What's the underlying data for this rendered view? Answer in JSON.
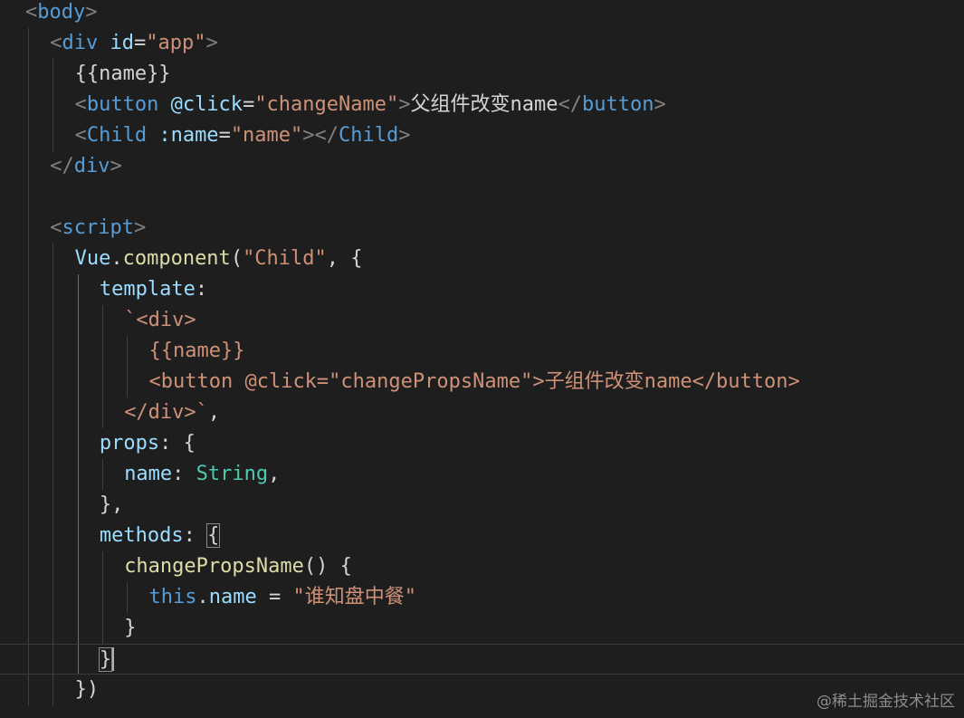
{
  "editor": {
    "language": "html",
    "lines": [
      [
        {
          "t": "punct",
          "v": "<"
        },
        {
          "t": "tag",
          "v": "body"
        },
        {
          "t": "punct",
          "v": ">"
        }
      ],
      [
        {
          "t": "punct",
          "v": "<"
        },
        {
          "t": "tag",
          "v": "div"
        },
        {
          "t": "text",
          "v": " "
        },
        {
          "t": "attr",
          "v": "id"
        },
        {
          "t": "text",
          "v": "="
        },
        {
          "t": "string",
          "v": "\"app\""
        },
        {
          "t": "punct",
          "v": ">"
        }
      ],
      [
        {
          "t": "text",
          "v": "{{name}}"
        }
      ],
      [
        {
          "t": "punct",
          "v": "<"
        },
        {
          "t": "tag",
          "v": "button"
        },
        {
          "t": "text",
          "v": " "
        },
        {
          "t": "attr",
          "v": "@click"
        },
        {
          "t": "text",
          "v": "="
        },
        {
          "t": "string",
          "v": "\"changeName\""
        },
        {
          "t": "punct",
          "v": ">"
        },
        {
          "t": "text",
          "v": "父组件改变name"
        },
        {
          "t": "punct",
          "v": "</"
        },
        {
          "t": "tag",
          "v": "button"
        },
        {
          "t": "punct",
          "v": ">"
        }
      ],
      [
        {
          "t": "punct",
          "v": "<"
        },
        {
          "t": "tag",
          "v": "Child"
        },
        {
          "t": "text",
          "v": " "
        },
        {
          "t": "attr",
          "v": ":name"
        },
        {
          "t": "text",
          "v": "="
        },
        {
          "t": "string",
          "v": "\"name\""
        },
        {
          "t": "punct",
          "v": "></"
        },
        {
          "t": "tag",
          "v": "Child"
        },
        {
          "t": "punct",
          "v": ">"
        }
      ],
      [
        {
          "t": "punct",
          "v": "</"
        },
        {
          "t": "tag",
          "v": "div"
        },
        {
          "t": "punct",
          "v": ">"
        }
      ],
      [],
      [
        {
          "t": "punct",
          "v": "<"
        },
        {
          "t": "tag",
          "v": "script"
        },
        {
          "t": "punct",
          "v": ">"
        }
      ],
      [
        {
          "t": "prop",
          "v": "Vue"
        },
        {
          "t": "text",
          "v": "."
        },
        {
          "t": "func",
          "v": "component"
        },
        {
          "t": "text",
          "v": "("
        },
        {
          "t": "string",
          "v": "\"Child\""
        },
        {
          "t": "text",
          "v": ", {"
        }
      ],
      [
        {
          "t": "prop",
          "v": "template"
        },
        {
          "t": "text",
          "v": ":"
        }
      ],
      [
        {
          "t": "string",
          "v": "`<div>"
        }
      ],
      [
        {
          "t": "string",
          "v": "{{name}}"
        }
      ],
      [
        {
          "t": "string",
          "v": "<button @click=\"changePropsName\">子组件改变name</button>"
        }
      ],
      [
        {
          "t": "string",
          "v": "</div>`"
        },
        {
          "t": "text",
          "v": ","
        }
      ],
      [
        {
          "t": "prop",
          "v": "props"
        },
        {
          "t": "text",
          "v": ": {"
        }
      ],
      [
        {
          "t": "prop",
          "v": "name"
        },
        {
          "t": "text",
          "v": ": "
        },
        {
          "t": "type",
          "v": "String"
        },
        {
          "t": "text",
          "v": ","
        }
      ],
      [
        {
          "t": "text",
          "v": "},"
        }
      ],
      [
        {
          "t": "prop",
          "v": "methods"
        },
        {
          "t": "text",
          "v": ": "
        },
        {
          "t": "bracketmatch",
          "v": "{"
        }
      ],
      [
        {
          "t": "func",
          "v": "changePropsName"
        },
        {
          "t": "text",
          "v": "() {"
        }
      ],
      [
        {
          "t": "keyword",
          "v": "this"
        },
        {
          "t": "text",
          "v": "."
        },
        {
          "t": "prop",
          "v": "name"
        },
        {
          "t": "text",
          "v": " = "
        },
        {
          "t": "string",
          "v": "\"谁知盘中餐\""
        }
      ],
      [
        {
          "t": "text",
          "v": "}"
        }
      ],
      [
        {
          "t": "bracketmatch",
          "v": "}"
        }
      ],
      [
        {
          "t": "text",
          "v": "})"
        }
      ]
    ],
    "indents": [
      0,
      1,
      2,
      2,
      2,
      1,
      0,
      1,
      2,
      3,
      4,
      5,
      5,
      4,
      3,
      4,
      3,
      3,
      4,
      5,
      4,
      3,
      2
    ],
    "current_line": 21
  },
  "watermark": {
    "text": "@稀土掘金技术社区"
  },
  "colors": {
    "background": "#1e1e1e",
    "tag": "#569cd6",
    "attribute": "#9cdcfe",
    "string": "#ce9178",
    "function": "#dcdcaa",
    "type": "#4ec9b0",
    "punctuation": "#808080",
    "text": "#d4d4d4"
  }
}
